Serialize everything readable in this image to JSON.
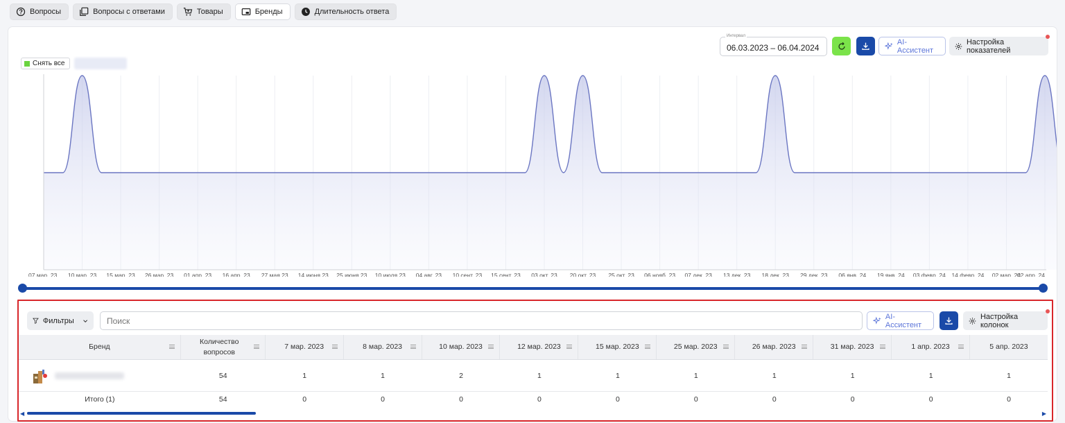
{
  "tabs": [
    {
      "label": "Вопросы",
      "icon": "question-circle-icon"
    },
    {
      "label": "Вопросы с ответами",
      "icon": "copy-stack-icon"
    },
    {
      "label": "Товары",
      "icon": "cart-icon"
    },
    {
      "label": "Бренды",
      "icon": "picture-in-picture-icon",
      "active": true
    },
    {
      "label": "Длительность ответа",
      "icon": "clock-icon"
    }
  ],
  "toolbar": {
    "interval_label": "Интервал",
    "interval_value": "06.03.2023 – 06.04.2024",
    "ai_label": "AI-Ассистент",
    "settings_label": "Настройка показателей"
  },
  "legend": {
    "deselect_all": "Снять все"
  },
  "colors": {
    "accent": "#1a4aa8",
    "green": "#7be34a",
    "line": "#6b76c2",
    "highlight": "#d8262a"
  },
  "chart_data": {
    "type": "area",
    "x_ticks": [
      "07 мар. 23",
      "10 мар. 23",
      "15 мар. 23",
      "26 мар. 23",
      "01 апр. 23",
      "16 апр. 23",
      "27 мая 23",
      "14 июня 23",
      "25 июня 23",
      "10 июля 23",
      "04 авг. 23",
      "10 сент. 23",
      "15 сент. 23",
      "03 окт. 23",
      "20 окт. 23",
      "25 окт. 23",
      "06 нояб. 23",
      "07 дек. 23",
      "13 дек. 23",
      "18 дек. 23",
      "29 дек. 23",
      "06 янв. 24",
      "19 янв. 24",
      "03 февр. 24",
      "14 февр. 24",
      "02 мар. 24",
      "02 апр. 24"
    ],
    "values": [
      1,
      2,
      1,
      1,
      1,
      1,
      1,
      1,
      1,
      1,
      1,
      1,
      1,
      2,
      2,
      1,
      1,
      1,
      1,
      2,
      1,
      1,
      1,
      1,
      1,
      1,
      2
    ],
    "ylim": [
      0,
      2
    ],
    "grid": true,
    "legend": "top-left"
  },
  "table": {
    "filters_label": "Фильтры",
    "search_placeholder": "Поиск",
    "ai_label": "AI-Ассистент",
    "columns_label": "Настройка колонок",
    "headers": [
      "Бренд",
      "Количество вопросов",
      "7 мар. 2023",
      "8 мар. 2023",
      "10 мар. 2023",
      "12 мар. 2023",
      "15 мар. 2023",
      "25 мар. 2023",
      "26 мар. 2023",
      "31 мар. 2023",
      "1 апр. 2023",
      "5 апр. 2023"
    ],
    "row": [
      "54",
      "1",
      "1",
      "2",
      "1",
      "1",
      "1",
      "1",
      "1",
      "1",
      "1"
    ],
    "total_label": "Итого (1)",
    "total": [
      "54",
      "0",
      "0",
      "0",
      "0",
      "0",
      "0",
      "0",
      "0",
      "0",
      "0"
    ]
  }
}
